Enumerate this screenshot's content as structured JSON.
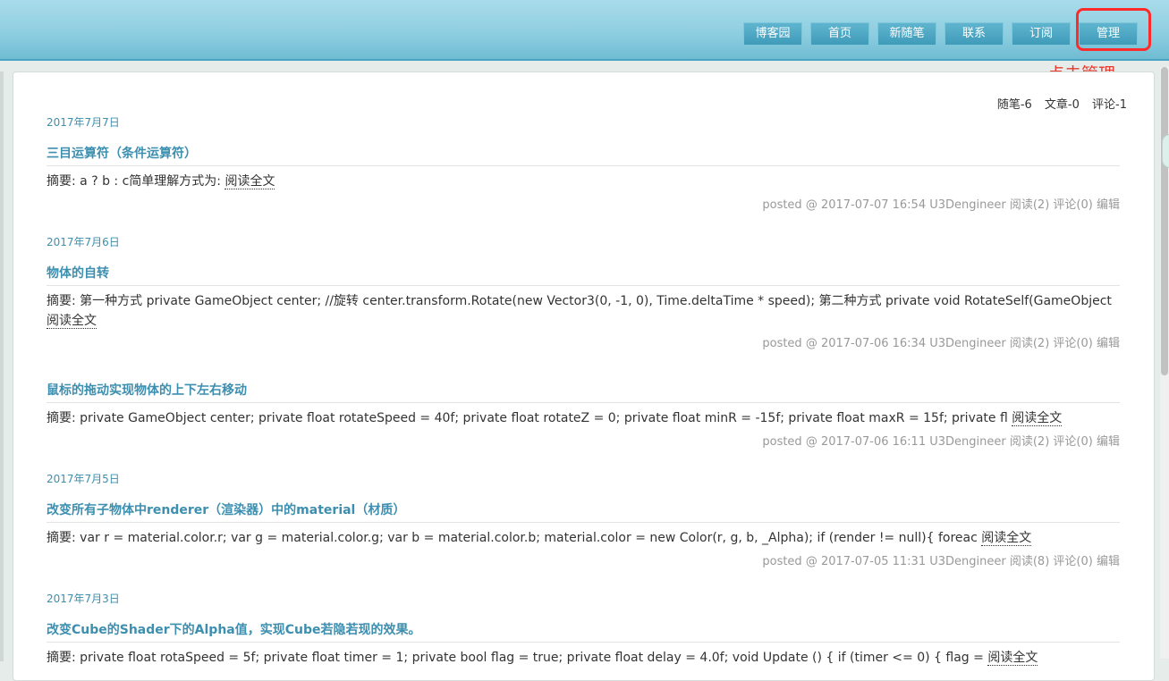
{
  "nav": {
    "items": [
      "博客园",
      "首页",
      "新随笔",
      "联系",
      "订阅",
      "管理"
    ]
  },
  "annotation": "点击管理",
  "stats": {
    "posts": "随笔-6",
    "articles": "文章-0",
    "comments": "评论-1"
  },
  "posts": [
    {
      "date": "2017年7月7日",
      "title": "三目运算符（条件运算符）",
      "summary": "摘要: a ? b : c简单理解方式为:",
      "read_more": "阅读全文",
      "meta": "posted @ 2017-07-07 16:54 U3Dengineer",
      "reads": "阅读(2)",
      "comments": "评论(0)",
      "edit": "编辑"
    },
    {
      "date": "2017年7月6日",
      "title": "物体的自转",
      "summary": "摘要: 第一种方式 private GameObject center; //旋转 center.transform.Rotate(new Vector3(0, -1, 0), Time.deltaTime * speed); 第二种方式 private void RotateSelf(GameObject",
      "read_more": "阅读全文",
      "meta": "posted @ 2017-07-06 16:34 U3Dengineer",
      "reads": "阅读(2)",
      "comments": "评论(0)",
      "edit": "编辑"
    },
    {
      "date": "",
      "title": "鼠标的拖动实现物体的上下左右移动",
      "summary": "摘要: private GameObject center; private float rotateSpeed = 40f; private float rotateZ = 0; private float minR = -15f; private float maxR = 15f; private fl",
      "read_more": "阅读全文",
      "meta": "posted @ 2017-07-06 16:11 U3Dengineer",
      "reads": "阅读(2)",
      "comments": "评论(0)",
      "edit": "编辑"
    },
    {
      "date": "2017年7月5日",
      "title": "改变所有子物体中renderer（渲染器）中的material（材质）",
      "summary": "摘要: var r = material.color.r; var g = material.color.g; var b = material.color.b; material.color = new Color(r, g, b, _Alpha); if (render != null){ foreac",
      "read_more": "阅读全文",
      "meta": "posted @ 2017-07-05 11:31 U3Dengineer",
      "reads": "阅读(8)",
      "comments": "评论(0)",
      "edit": "编辑"
    },
    {
      "date": "2017年7月3日",
      "title": "改变Cube的Shader下的Alpha值，实现Cube若隐若现的效果。",
      "summary": "摘要: private float rotaSpeed = 5f; private float timer = 1; private bool flag = true; private float delay = 4.0f; void Update () { if (timer <= 0) { flag =",
      "read_more": "阅读全文"
    }
  ]
}
